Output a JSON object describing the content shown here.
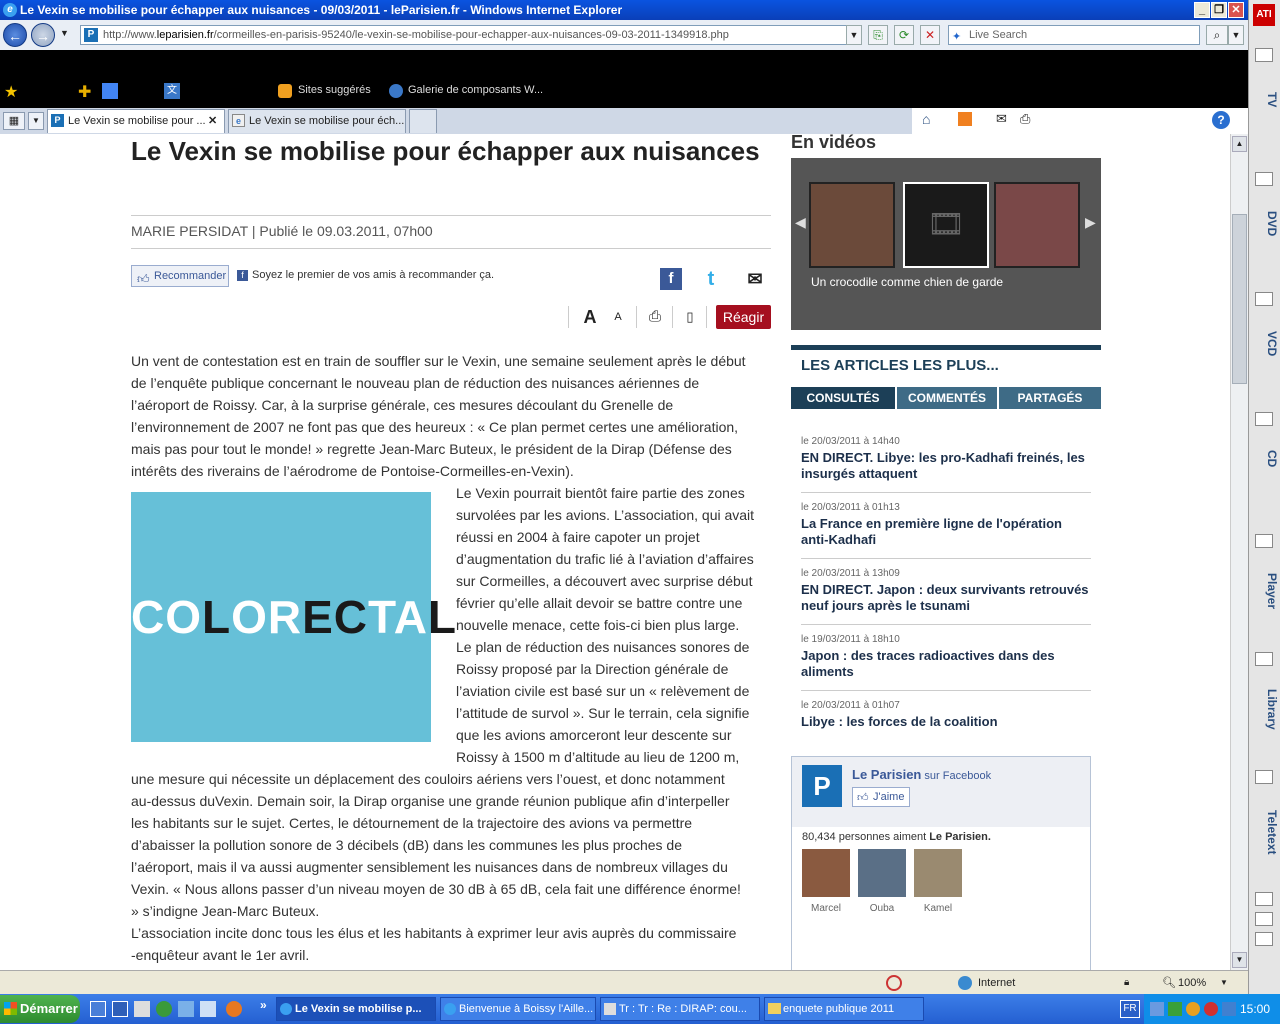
{
  "window": {
    "title": "Le Vexin se mobilise pour échapper aux nuisances - 09/03/2011 - leParisien.fr - Windows Internet Explorer"
  },
  "toolbar": {
    "url_prefix": "http://www.",
    "url_domain": "leparisien.fr",
    "url_rest": "/cormeilles-en-parisis-95240/le-vexin-se-mobilise-pour-echapper-aux-nuisances-09-03-2011-1349918.php",
    "search_placeholder": "Live Search"
  },
  "favorites_bar": {
    "items": [
      "Sites suggérés",
      "Galerie de composants W..."
    ]
  },
  "tabs": [
    {
      "label": "Le Vexin se mobilise pour ...",
      "active": true
    },
    {
      "label": "Le Vexin se mobilise pour éch...",
      "active": false
    }
  ],
  "article": {
    "title": "Le Vexin se mobilise pour échapper aux nuisances",
    "byline": "MARIE PERSIDAT | Publié le 09.03.2011, 07h00",
    "recommend_label": "Recommander",
    "fb_prompt": "Soyez le premier de vos amis à recommander ça.",
    "font_large": "A",
    "font_small": "A",
    "reagir": "Réagir",
    "image_text_light_1": "CO",
    "image_text_dark_1": "L",
    "image_text_light_2": "OR",
    "image_text_dark_2": "EC",
    "image_text_light_3": "TA",
    "image_text_dark_3": "L",
    "para1": [
      "Un vent de contestation est en train de souffler sur le Vexin, une semaine seulement après le début",
      "de l’enquête publique concernant le nouveau plan de réduction des nuisances aériennes de",
      "l’aéroport de Roissy. Car, à la surprise générale, ces mesures découlant du Grenelle de",
      "l’environnement de 2007 ne font pas que des heureux : « Ce plan permet certes une amélioration,",
      "mais pas pour tout le monde! » regrette Jean-Marc Buteux, le président de la Dirap (Défense des",
      "intérêts des riverains de l’aérodrome de Pontoise-Cormeilles-en-Vexin)."
    ],
    "para2": [
      "Le Vexin pourrait bientôt faire partie des zones",
      "survolées par les avions. L’association, qui avait",
      "réussi en 2004 à faire capoter un projet",
      "d’augmentation du trafic lié à l’aviation d’affaires",
      "sur Cormeilles, a découvert avec surprise début",
      "février qu’elle allait devoir se battre contre une",
      "nouvelle menace, cette fois-ci bien plus large.",
      "Le plan de réduction des nuisances sonores de",
      "Roissy proposé par la Direction générale de",
      "l’aviation civile est basé sur un « relèvement de",
      "l’attitude de survol ». Sur le terrain, cela signifie",
      "que les avions amorceront leur descente sur",
      "Roissy à 1500 m d’altitude au lieu de 1200 m,"
    ],
    "para3": [
      "une mesure qui nécessite un déplacement des couloirs aériens vers l’ouest, et donc notamment",
      "au-dessus duVexin. Demain soir, la Dirap organise une grande réunion publique afin d’interpeller",
      "les habitants sur le sujet. Certes, le détournement de la trajectoire des avions va permettre",
      "d’abaisser la pollution sonore de 3 décibels (dB) dans les communes les plus proches de",
      "l’aéroport, mais il va aussi augmenter sensiblement les nuisances dans de nombreux villages du",
      "Vexin. « Nous allons passer d’un niveau moyen de 30 dB à 65 dB, cela fait une différence énorme!",
      "» s’indigne Jean-Marc Buteux.",
      "L’association incite donc tous les élus et les habitants à exprimer leur avis auprès du commissaire",
      "-enquêteur avant le 1er avril."
    ]
  },
  "sidebar": {
    "videos_heading": "En vidéos",
    "video_caption": "Un crocodile comme chien de garde",
    "most_title": "LES ARTICLES LES PLUS...",
    "most_tabs": [
      "CONSULTÉS",
      "COMMENTÉS",
      "PARTAGÉS"
    ],
    "items": [
      {
        "date": "le 20/03/2011 à 14h40",
        "title": "EN DIRECT. Libye: les pro-Kadhafi freinés, les insurgés attaquent"
      },
      {
        "date": "le 20/03/2011 à 01h13",
        "title": "La France en première ligne de l'opération anti-Kadhafi"
      },
      {
        "date": "le 20/03/2011 à 13h09",
        "title": "EN DIRECT. Japon : deux survivants retrouvés neuf jours après le tsunami"
      },
      {
        "date": "le 19/03/2011 à 18h10",
        "title": "Japon : des traces radioactives dans des aliments"
      },
      {
        "date": "le 20/03/2011 à 01h07",
        "title": "Libye : les forces de la coalition"
      }
    ],
    "facebook": {
      "name": "Le Parisien",
      "sur": " sur Facebook",
      "like": "J'aime",
      "count_text": "80,434 personnes aiment ",
      "count_name": "Le Parisien.",
      "fans": [
        "Marcel",
        "Ouba",
        "Kamel"
      ]
    }
  },
  "media_sidebar": {
    "labels": [
      "TV",
      "DVD",
      "VCD",
      "CD",
      "Player",
      "Library",
      "Teletext"
    ]
  },
  "status": {
    "zone": "Internet",
    "zoom": "100%"
  },
  "taskbar": {
    "start": "Démarrer",
    "tasks": [
      "Le Vexin se mobilise p...",
      "Bienvenue à Boissy l'Aille...",
      "Tr : Tr : Re : DIRAP: cou...",
      "enquete publique 2011"
    ],
    "lang": "FR",
    "clock": "15:00"
  }
}
